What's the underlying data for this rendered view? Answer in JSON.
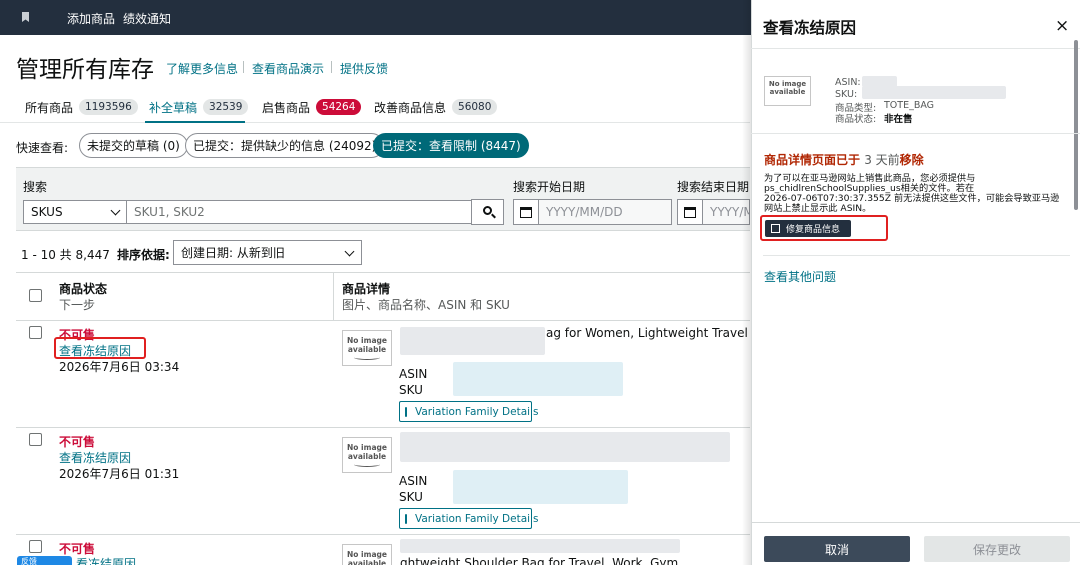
{
  "topbar": {
    "links": [
      "添加商品",
      "绩效通知"
    ]
  },
  "header": {
    "title": "管理所有库存",
    "links": [
      "了解更多信息",
      "查看商品演示",
      "提供反馈"
    ]
  },
  "tabs": [
    {
      "label": "所有商品",
      "count": "1193596"
    },
    {
      "label": "补全草稿",
      "count": "32539"
    },
    {
      "label": "启售商品",
      "count": "54264"
    },
    {
      "label": "改善商品信息",
      "count": "56080"
    }
  ],
  "quick_view": {
    "label": "快速查看:",
    "pills": [
      "未提交的草稿 (0)",
      "已提交：提供缺少的信息 (24092)",
      "已提交：查看限制 (8447)"
    ]
  },
  "search": {
    "label": "搜索",
    "select_value": "SKUS",
    "input_placeholder": "SKU1, SKU2",
    "start_label": "搜索开始日期",
    "end_label": "搜索结束日期",
    "date_placeholder": "YYYY/MM/DD",
    "date_placeholder_cut": "YYYY/M"
  },
  "results": {
    "count": "1 - 10 共 8,447",
    "sort_label": "排序依据:",
    "sort_value": "创建日期:  从新到旧"
  },
  "table": {
    "col1_title": "商品状态",
    "col1_sub": "下一步",
    "col2_title": "商品详情",
    "col2_sub": "图片、商品名称、ASIN 和 SKU",
    "rows": [
      {
        "status": "不可售",
        "link": "查看冻结原因",
        "date": "2026年7月6日 03:34",
        "title_visible": "ag for Women, Lightweight Travel",
        "asin_label": "ASIN",
        "sku_label": "SKU",
        "button": "Variation Family Details"
      },
      {
        "status": "不可售",
        "link": "查看冻结原因",
        "date": "2026年7月6日 01:31",
        "title_visible": "",
        "asin_label": "ASIN",
        "sku_label": "SKU",
        "button": "Variation Family Details"
      },
      {
        "status": "不可售",
        "link": "看冻结原因",
        "date": "",
        "title_visible": "ghtweight Shoulder Bag for Travel, Work, Gym",
        "asin_label": "",
        "sku_label": "",
        "button": ""
      }
    ],
    "noimg_line1": "No image",
    "noimg_line2": "available"
  },
  "feedback_tab": "反馈",
  "panel": {
    "title": "查看冻结原因",
    "close": "×",
    "asin_label": "ASIN:",
    "sku_label": "SKU:",
    "type_label": "商品类型:",
    "type_value": "TOTE_BAG",
    "status_label": "商品状态:",
    "status_value": "非在售",
    "heading_a": "商品详情页面已于",
    "heading_b": "3 天前",
    "heading_c": "移除",
    "desc_lines": [
      "为了可以在亚马逊网站上销售此商品，您必须提供与",
      "ps_chidlrenSchoolSupplies_us相关的文件。若在",
      "2026-07-06T07:30:37.355Z 前无法提供这些文件，可能会导致亚马逊",
      "网站上禁止显示此 ASIN。"
    ],
    "fix_button": "修复商品信息",
    "other_link": "查看其他问题",
    "cancel": "取消",
    "save": "保存更改"
  }
}
